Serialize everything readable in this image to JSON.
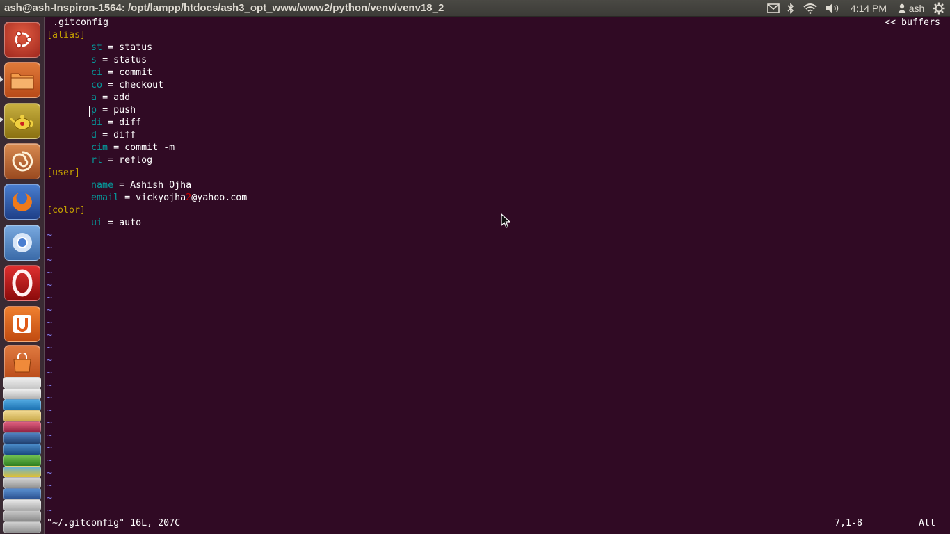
{
  "window": {
    "title": "ash@ash-Inspiron-1564: /opt/lampp/htdocs/ash3_opt_www/www2/python/venv/venv18_2"
  },
  "panel": {
    "clock": "4:14 PM",
    "user": "ash",
    "indicators": [
      "mail-icon",
      "bluetooth-icon",
      "wifi-icon",
      "volume-icon",
      "gear-icon"
    ]
  },
  "launcher": {
    "items": [
      {
        "name": "ubuntu-dash",
        "icon": "ubuntu-logo-icon",
        "color": "#c2352a"
      },
      {
        "name": "files",
        "icon": "folder-icon",
        "color": "#e66b1f"
      },
      {
        "name": "genie",
        "icon": "teapot-icon",
        "color": "#c8a820"
      },
      {
        "name": "shell",
        "icon": "nautilus-shell-icon",
        "color": "#d06a30"
      },
      {
        "name": "firefox",
        "icon": "firefox-icon",
        "color": "#e8661e"
      },
      {
        "name": "chromium",
        "icon": "chromium-icon",
        "color": "#5a8fd0"
      },
      {
        "name": "opera",
        "icon": "opera-icon",
        "color": "#cc1010"
      },
      {
        "name": "ubuntu-one",
        "icon": "ubuntu-one-icon",
        "color": "#e0601a"
      },
      {
        "name": "software-center",
        "icon": "shopping-bag-icon",
        "color": "#d85a1c"
      }
    ]
  },
  "editor": {
    "tab_name": ".gitconfig",
    "buffers_label": "<< buffers",
    "lines": [
      {
        "type": "section",
        "text": "[alias]"
      },
      {
        "type": "kv",
        "key": "st",
        "value": "status"
      },
      {
        "type": "kv",
        "key": "s",
        "value": "status"
      },
      {
        "type": "kv",
        "key": "ci",
        "value": "commit"
      },
      {
        "type": "kv",
        "key": "co",
        "value": "checkout"
      },
      {
        "type": "kv",
        "key": "a",
        "value": "add"
      },
      {
        "type": "kv",
        "key": "p",
        "value": "push"
      },
      {
        "type": "kv",
        "key": "di",
        "value": "diff"
      },
      {
        "type": "kv",
        "key": "d",
        "value": "diff"
      },
      {
        "type": "kv",
        "key": "cim",
        "value": "commit -m"
      },
      {
        "type": "kv",
        "key": "rl",
        "value": "reflog"
      },
      {
        "type": "section",
        "text": "[user]"
      },
      {
        "type": "kv",
        "key": "name",
        "value": "Ashish Ojha"
      },
      {
        "type": "email",
        "key": "email",
        "value_before": "vickyojha",
        "value_typo": "2",
        "value_after": "@yahoo.com"
      },
      {
        "type": "section",
        "text": "[color]"
      },
      {
        "type": "kv",
        "key": "ui",
        "value": "auto"
      }
    ],
    "tilde_char": "~",
    "tilde_count": 23
  },
  "statusline": {
    "file_info": "\"~/.gitconfig\" 16L, 207C",
    "position": "7,1-8",
    "percent": "All"
  },
  "colors": {
    "background": "#300a24",
    "key": "#06989a",
    "section": "#c4a000",
    "tilde": "#8080f0"
  }
}
